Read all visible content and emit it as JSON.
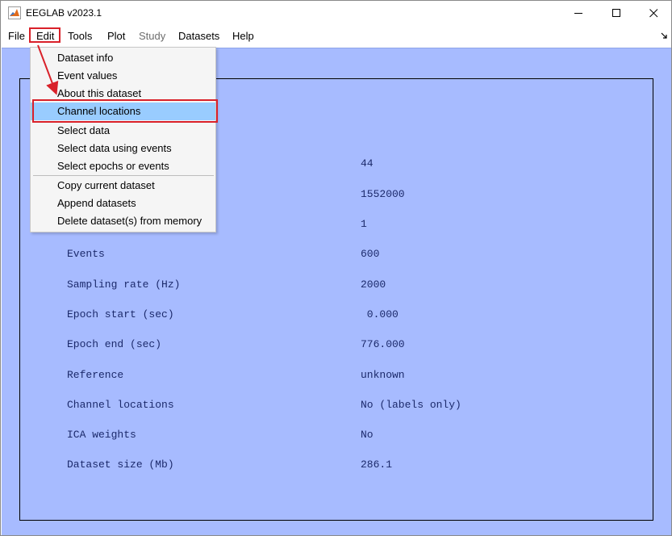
{
  "window": {
    "title": "EEGLAB v2023.1",
    "app_icon": "matlab-icon",
    "controls": [
      "minimize-icon",
      "maximize-icon",
      "close-icon"
    ]
  },
  "menubar": {
    "items": [
      {
        "label": "File",
        "enabled": true
      },
      {
        "label": "Edit",
        "enabled": true
      },
      {
        "label": "Tools",
        "enabled": true
      },
      {
        "label": "Plot",
        "enabled": true
      },
      {
        "label": "Study",
        "enabled": false
      },
      {
        "label": "Datasets",
        "enabled": true
      },
      {
        "label": "Help",
        "enabled": true
      }
    ]
  },
  "edit_menu": {
    "items": [
      {
        "label": "Dataset info"
      },
      {
        "label": "Event values"
      },
      {
        "label": "About this dataset"
      },
      {
        "label": "Channel locations",
        "highlighted": true
      },
      {
        "label": "Select data"
      },
      {
        "label": "Select data using events"
      },
      {
        "label": "Select epochs or events"
      },
      {
        "label": "Copy current dataset"
      },
      {
        "label": "Append datasets"
      },
      {
        "label": "Delete dataset(s) from memory"
      }
    ]
  },
  "dataset_info": {
    "rows": [
      {
        "label": "",
        "value": "44"
      },
      {
        "label": "",
        "value": "1552000"
      },
      {
        "label": "",
        "value": "1"
      },
      {
        "label": "Events",
        "value": "600"
      },
      {
        "label": "Sampling rate (Hz)",
        "value": "2000"
      },
      {
        "label": "Epoch start (sec)",
        "value": " 0.000"
      },
      {
        "label": "Epoch end (sec)",
        "value": "776.000"
      },
      {
        "label": "Reference",
        "value": "unknown"
      },
      {
        "label": "Channel locations",
        "value": "No (labels only)"
      },
      {
        "label": "ICA weights",
        "value": "No"
      },
      {
        "label": "Dataset size (Mb)",
        "value": "286.1"
      }
    ]
  },
  "colors": {
    "client_background": "#a7bbff",
    "info_text": "#1c2a6b",
    "highlight_item": "#99ccff",
    "annotation_red": "#d9212a"
  }
}
